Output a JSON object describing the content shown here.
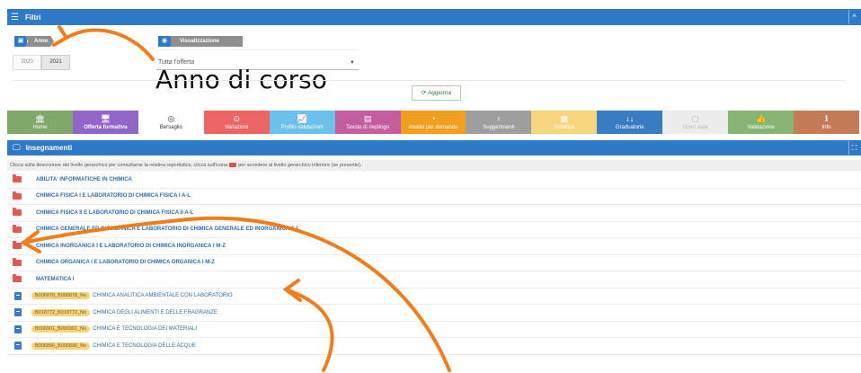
{
  "filters": {
    "title": "Filtri",
    "collapse": "^",
    "year_label": "Anno",
    "view_label": "Visualizzazione",
    "years": [
      "2020",
      "2021"
    ],
    "selected_year": "2021",
    "offer_select": "Tutta l'offerta",
    "update_button": "Aggiorna"
  },
  "annotation": {
    "text": "Anno di corso"
  },
  "nav": {
    "tiles": [
      {
        "label": "Home",
        "color": "#7fa86a",
        "icon": "🏛"
      },
      {
        "label": "Offerta formativa",
        "color": "#9266c9",
        "icon": "🖥",
        "active": true
      },
      {
        "label": "Bersaglio",
        "color": "#ffffff",
        "icon": "◎"
      },
      {
        "label": "Variazioni",
        "color": "#ec6666",
        "icon": "⊙"
      },
      {
        "label": "Profilo valutazioni",
        "color": "#6bc1ec",
        "icon": "📈"
      },
      {
        "label": "Tavola di riepilogo",
        "color": "#c45ca0",
        "icon": "▤"
      },
      {
        "label": "Analisi per domanda",
        "color": "#f29e1e",
        "icon": "◔"
      },
      {
        "label": "Suggerimenti",
        "color": "#9e9e9e",
        "icon": "♀"
      },
      {
        "label": "Sinottico",
        "color": "#f7d67e",
        "icon": "▦"
      },
      {
        "label": "Graduatorie",
        "color": "#3a7cc4",
        "icon": "↓↓"
      },
      {
        "label": "Open data",
        "color": "#ececec",
        "icon": "▢"
      },
      {
        "label": "Validazione",
        "color": "#86b473",
        "icon": "👍"
      },
      {
        "label": "Info",
        "color": "#c47b57",
        "icon": "ℹ"
      }
    ]
  },
  "section": {
    "title": "Insegnamenti",
    "expand": "⛶",
    "hint_pre": "Clicca sulla descrizione del livello gerarchico per consultarne la relativa reportistica, clicca sull'icona",
    "hint_post": "per accedere al livello gerarchico inferiore (se presente)."
  },
  "folders": [
    "ABILITA' INFORMATICHE IN CHIMICA",
    "CHIMICA FISICA I E LABORATORIO DI CHIMICA FISICA I A-L",
    "CHIMICA FISICA II E LABORATORIO DI CHIMICA FISICA II A-L",
    "CHIMICA GENERALE ED INORGANICA E LABORATORIO DI CHIMICA GENERALE ED INORGANICA A-L",
    "CHIMICA INORGANICA I E LABORATORIO DI CHIMICA INORGANICA I M-Z",
    "CHIMICA ORGANICA I E LABORATORIO DI CHIMICA ORGANICA I M-Z",
    "MATEMATICA I"
  ],
  "courses": [
    {
      "code": "B006878_B006878_No",
      "name": "CHIMICA ANALITICA AMBIENTALE CON LABORATORIO"
    },
    {
      "code": "B018772_B018772_No",
      "name": "CHIMICA DEGLI ALIMENTI E DELLE FRAGRANZE"
    },
    {
      "code": "B006901_B006901_No",
      "name": "CHIMICA E TECNOLOGIA DEI MATERIALI"
    },
    {
      "code": "B006896_B006896_No",
      "name": "CHIMICA E TECNOLOGIA DELLE ACQUE"
    }
  ],
  "colors": {
    "primary": "#2e7ac7",
    "folder": "#e05a4f",
    "code_badge": "#f7d37c",
    "arrow": "#f07d1c"
  }
}
